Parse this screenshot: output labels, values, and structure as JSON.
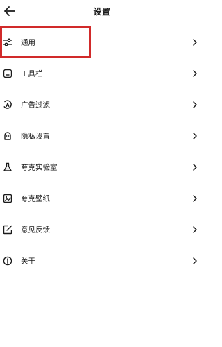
{
  "header": {
    "title": "设置",
    "back_icon": "back-arrow-icon"
  },
  "items": [
    {
      "id": "general",
      "label": "通用",
      "icon": "sliders-icon"
    },
    {
      "id": "toolbar",
      "label": "工具栏",
      "icon": "toolbar-icon"
    },
    {
      "id": "adblock",
      "label": "广告过滤",
      "icon": "adblock-icon"
    },
    {
      "id": "privacy",
      "label": "隐私设置",
      "icon": "privacy-icon"
    },
    {
      "id": "lab",
      "label": "夸克实验室",
      "icon": "flask-icon"
    },
    {
      "id": "wallpaper",
      "label": "夸克壁纸",
      "icon": "wallpaper-icon"
    },
    {
      "id": "feedback",
      "label": "意见反馈",
      "icon": "feedback-icon"
    },
    {
      "id": "about",
      "label": "关于",
      "icon": "info-icon"
    }
  ],
  "highlight": {
    "color": "#d12a2a",
    "target": "general"
  }
}
